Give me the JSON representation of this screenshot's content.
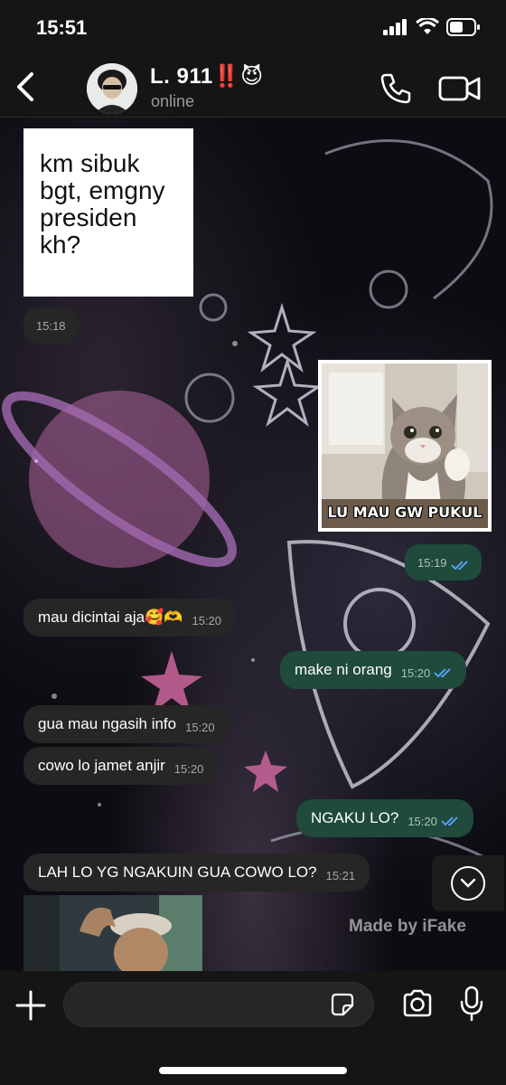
{
  "status_bar": {
    "time": "15:51"
  },
  "header": {
    "contact_name": "L. 911‼️😈",
    "contact_status": "online"
  },
  "messages": [
    {
      "type": "image",
      "direction": "in",
      "image_text": "km    sibuk bgt, emgny presiden kh?"
    },
    {
      "type": "time",
      "direction": "in",
      "time": "15:18"
    },
    {
      "type": "image",
      "direction": "out",
      "caption": "LU MAU GW PUKUL"
    },
    {
      "type": "time",
      "direction": "out",
      "time": "15:19"
    },
    {
      "type": "text",
      "direction": "in",
      "text": "mau dicintai aja🥰🫶",
      "time": "15:20"
    },
    {
      "type": "text",
      "direction": "out",
      "text": "make ni orang",
      "time": "15:20"
    },
    {
      "type": "text",
      "direction": "in",
      "text": "gua mau ngasih info",
      "time": "15:20"
    },
    {
      "type": "text",
      "direction": "in",
      "text": "cowo lo jamet anjir",
      "time": "15:20"
    },
    {
      "type": "text",
      "direction": "out",
      "text": "NGAKU LO?",
      "time": "15:20"
    },
    {
      "type": "text",
      "direction": "in",
      "text": "LAH LO YG NGAKUIN GUA COWO LO?",
      "time": "15:21"
    },
    {
      "type": "image",
      "direction": "in"
    }
  ],
  "watermark": "Made by iFake",
  "input": {
    "placeholder": ""
  },
  "colors": {
    "incoming_bubble": "#262626",
    "outgoing_bubble": "#1f4a3c",
    "read_ticks": "#5aa8ff"
  }
}
